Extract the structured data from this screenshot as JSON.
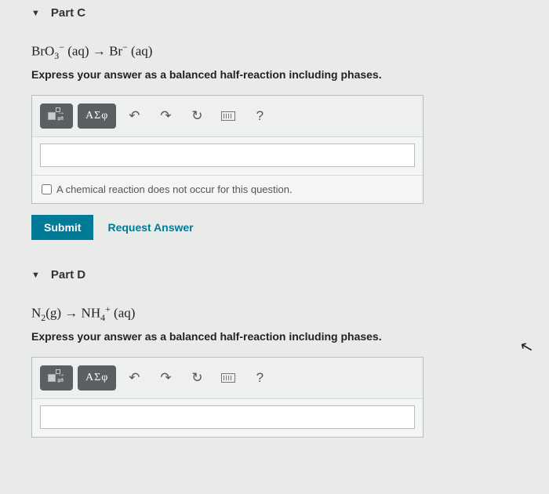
{
  "parts": {
    "c": {
      "label": "Part C",
      "formula_html": "BrO<span class='sub'>3</span><span class='sup'>−</span> (aq) → Br<span class='sup'>−</span> (aq)",
      "instruction": "Express your answer as a balanced half-reaction including phases.",
      "toolbar": {
        "greek": "ΑΣφ",
        "help": "?"
      },
      "no_reaction_label": "A chemical reaction does not occur for this question.",
      "submit": "Submit",
      "request": "Request Answer"
    },
    "d": {
      "label": "Part D",
      "formula_html": "N<span class='sub'>2</span>(g) → NH<span class='sub'>4</span><span class='sup'>+</span> (aq)",
      "instruction": "Express your answer as a balanced half-reaction including phases.",
      "toolbar": {
        "greek": "ΑΣφ",
        "help": "?"
      }
    }
  }
}
